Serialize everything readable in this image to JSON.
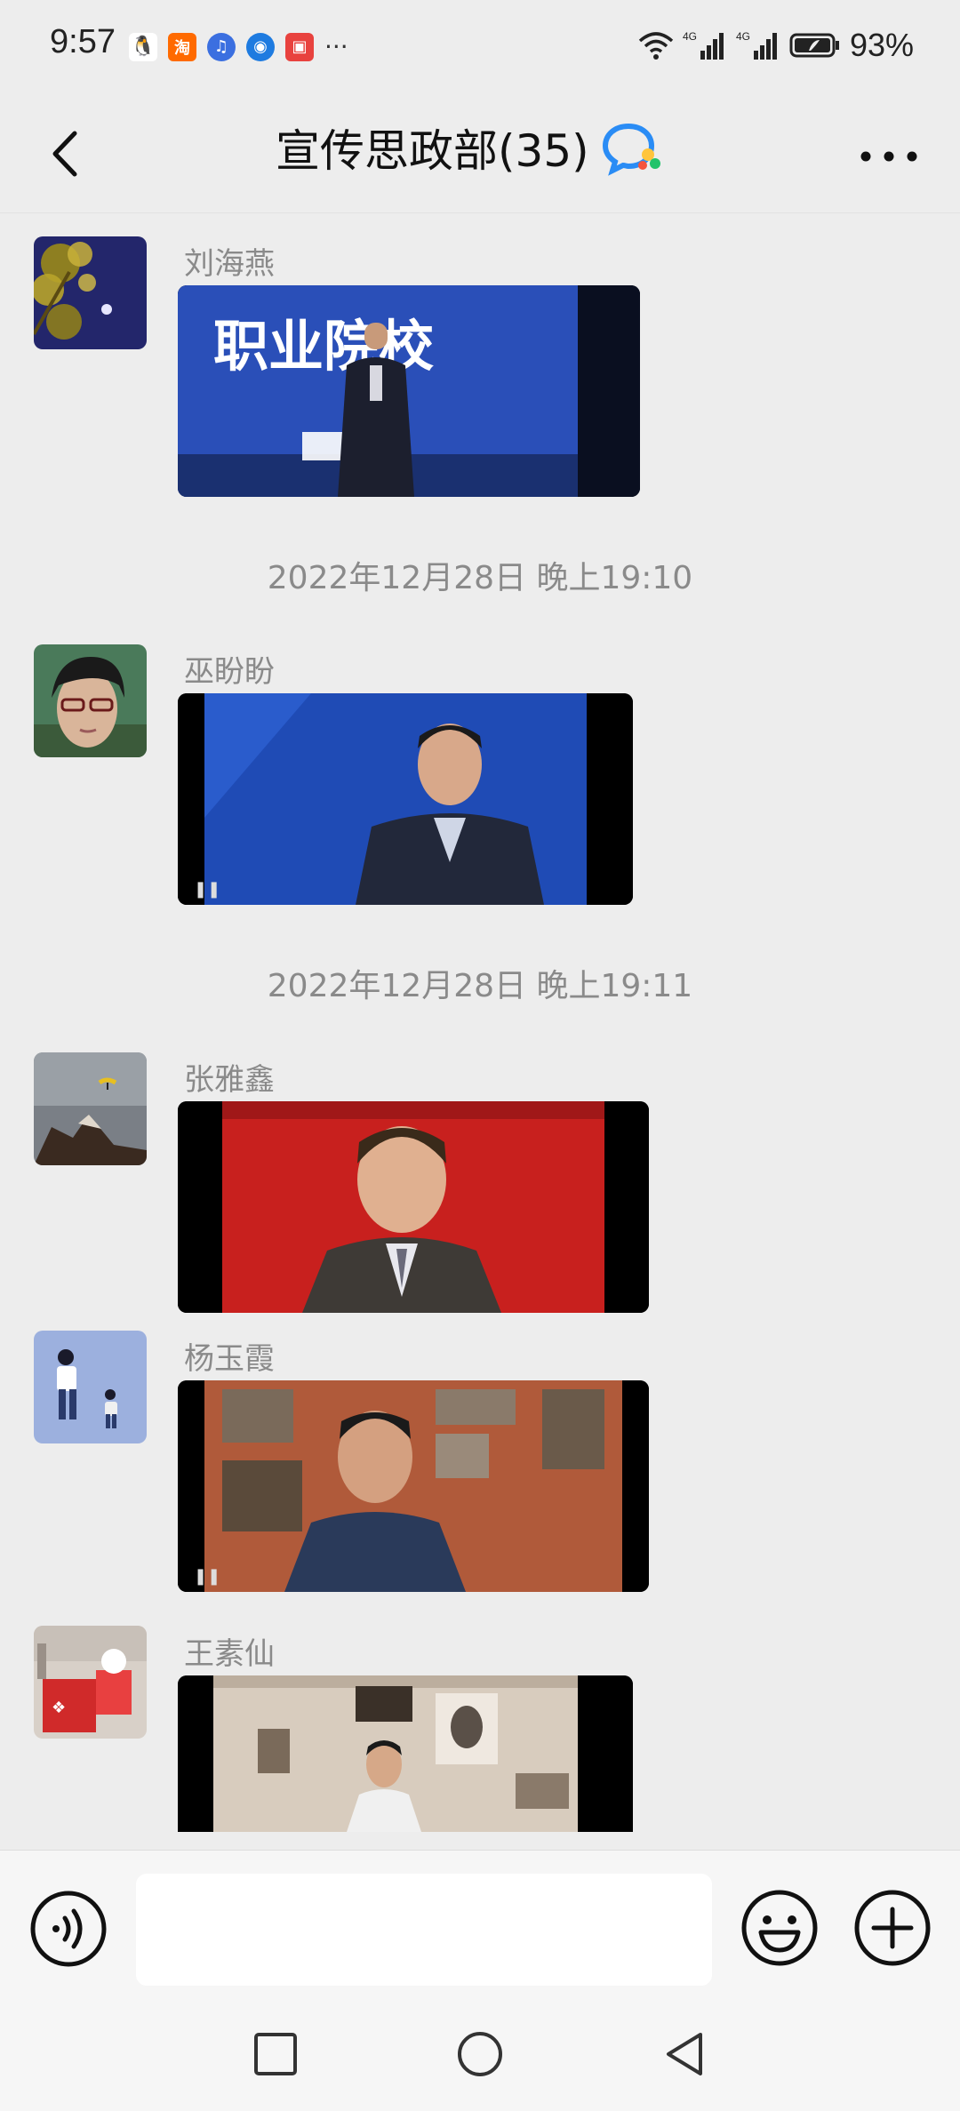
{
  "status_bar": {
    "time": "9:57",
    "apps": [
      {
        "icon": "qq-icon",
        "glyph": "🐧",
        "color": "#ffffff"
      },
      {
        "icon": "taobao-icon",
        "glyph": "淘",
        "color": "#ff6a00"
      },
      {
        "icon": "music-icon",
        "glyph": "♫",
        "color": "#3b6fe0"
      },
      {
        "icon": "browser-icon",
        "glyph": "◉",
        "color": "#1e7be0"
      },
      {
        "icon": "reader-icon",
        "glyph": "▣",
        "color": "#e8423e"
      }
    ],
    "more_glyph": "···",
    "network": "4G",
    "battery": "93%"
  },
  "header": {
    "title": "宣传思政部(35)",
    "back_icon": "chevron-left-icon",
    "more_icon": "more-dots-icon",
    "group_icon": "group-chat-icon"
  },
  "messages": [
    {
      "sender": "刘海燕",
      "video_caption": "职业院校"
    },
    {
      "timestamp": "2022年12月28日 晚上19:10"
    },
    {
      "sender": "巫盼盼"
    },
    {
      "timestamp": "2022年12月28日 晚上19:11"
    },
    {
      "sender": "张雅鑫"
    },
    {
      "sender": "杨玉霞"
    },
    {
      "sender": "王素仙"
    }
  ],
  "input_bar": {
    "voice_icon": "voice-icon",
    "emoji_icon": "emoji-icon",
    "plus_icon": "plus-icon",
    "input_value": ""
  },
  "system_nav": {
    "recent_icon": "recent-apps-icon",
    "home_icon": "home-icon",
    "back_icon": "back-triangle-icon"
  },
  "colors": {
    "background": "#ededed",
    "accent_blue": "#2a8cf5",
    "text_grey": "#8a8a8a"
  }
}
